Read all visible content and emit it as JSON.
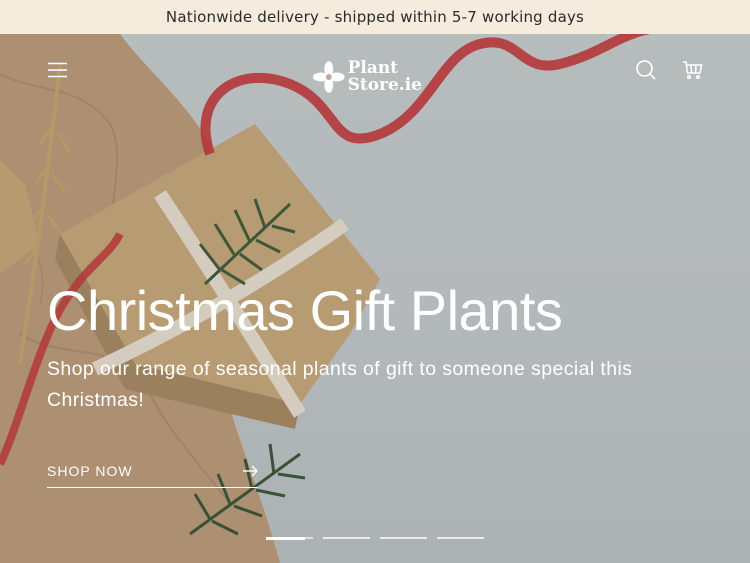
{
  "announcement": {
    "text": "Nationwide delivery - shipped within 5-7 working days"
  },
  "header": {
    "logo_line1": "Plant",
    "logo_line2": "Store.ie",
    "icons": [
      "menu-icon",
      "search-icon",
      "cart-icon"
    ]
  },
  "hero": {
    "title": "Christmas Gift Plants",
    "subtitle": "Shop our range of seasonal plants of gift to someone special this Christmas!",
    "cta_label": "SHOP NOW"
  },
  "slider": {
    "slide_count": 4,
    "active_slide": 1,
    "active_progress": 0.82
  },
  "colors": {
    "announcement_bg": "#f6ecdd",
    "text_on_hero": "#ffffff"
  }
}
